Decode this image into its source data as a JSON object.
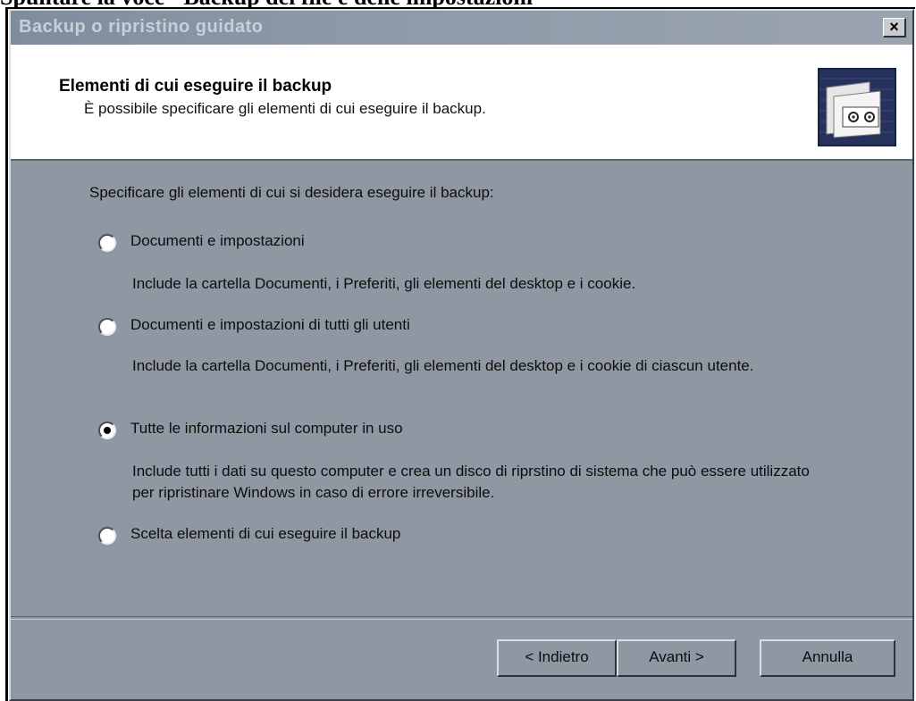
{
  "caption": "Spuntare la voce \"Backup dei file e delle impostazioni\"",
  "window": {
    "title": "Backup o ripristino guidato",
    "close_glyph": "×"
  },
  "header": {
    "title": "Elementi di cui eseguire il backup",
    "subtitle": "È possibile specificare gli elementi di cui eseguire il backup.",
    "icon": "backup-tape-icon"
  },
  "body": {
    "instruction": "Specificare gli elementi di cui si desidera eseguire il backup:",
    "options": [
      {
        "label": "Documenti e impostazioni",
        "description": "Include la cartella Documenti, i Preferiti, gli elementi del desktop e i cookie.",
        "selected": false
      },
      {
        "label": "Documenti e impostazioni di tutti gli utenti",
        "description": "Include la cartella Documenti, i Preferiti, gli elementi del desktop e i cookie di ciascun utente.",
        "selected": false
      },
      {
        "label": "Tutte le informazioni sul computer in uso",
        "description": "Include tutti i dati su questo computer e crea un disco di riprstino di sistema che può essere utilizzato per ripristinare Windows in caso di errore irreversibile.",
        "selected": true
      },
      {
        "label": "Scelta elementi di cui eseguire il backup",
        "description": "",
        "selected": false
      }
    ]
  },
  "buttons": {
    "back": "< Indietro",
    "next": "Avanti >",
    "cancel": "Annulla"
  },
  "colors": {
    "dialog_background": "#8f97a2",
    "header_background": "#ffffff"
  }
}
